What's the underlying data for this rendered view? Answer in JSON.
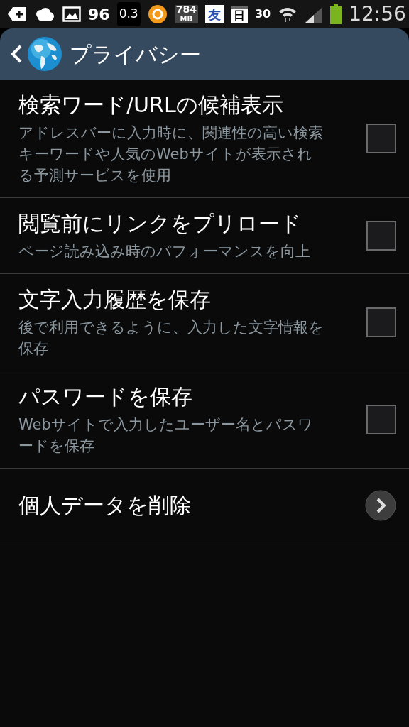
{
  "status_bar": {
    "items": [
      {
        "kind": "text",
        "text": "96"
      },
      {
        "kind": "boxed",
        "text": "0.3"
      },
      {
        "kind": "memory",
        "text": "784",
        "sub": "MB"
      },
      {
        "kind": "tile",
        "text": "友"
      },
      {
        "kind": "calendar",
        "text": "日"
      },
      {
        "kind": "small",
        "text": "30"
      }
    ],
    "time": "12:56"
  },
  "action_bar": {
    "title": "プライバシー"
  },
  "settings": [
    {
      "kind": "checkbox",
      "title": "検索ワード/URLの候補表示",
      "summary": "アドレスバーに入力時に、関連性の高い検索キーワードや人気のWebサイトが表示される予測サービスを使用",
      "checked": false
    },
    {
      "kind": "checkbox",
      "title": "閲覧前にリンクをプリロード",
      "summary": "ページ読み込み時のパフォーマンスを向上",
      "checked": false
    },
    {
      "kind": "checkbox",
      "title": "文字入力履歴を保存",
      "summary": "後で利用できるように、入力した文字情報を保存",
      "checked": false
    },
    {
      "kind": "checkbox",
      "title": "パスワードを保存",
      "summary": "Webサイトで入力したユーザー名とパスワードを保存",
      "checked": false
    },
    {
      "kind": "link",
      "title": "個人データを削除"
    }
  ]
}
